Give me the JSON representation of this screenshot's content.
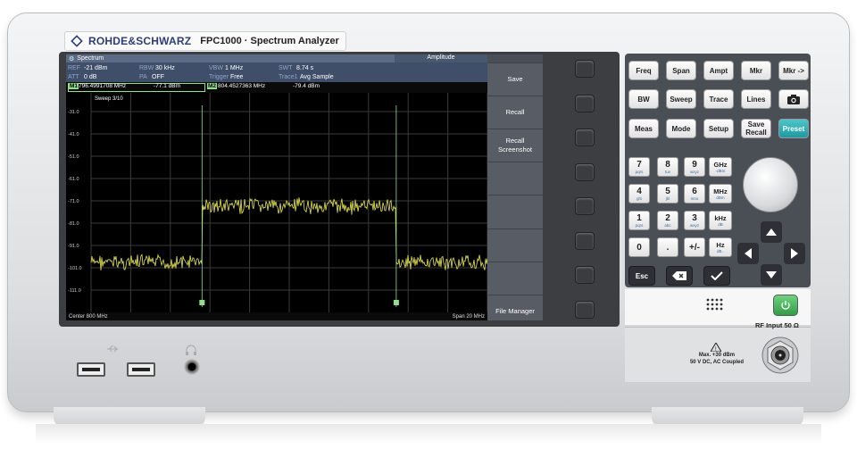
{
  "brand": {
    "name": "ROHDE&SCHWARZ",
    "model": "FPC1000 · Spectrum Analyzer"
  },
  "screen": {
    "mode_tab": "Spectrum",
    "menu_title": "Amplitude",
    "params": [
      {
        "label": "REF",
        "value": "-21 dBm"
      },
      {
        "label": "RBW",
        "value": "30 kHz"
      },
      {
        "label": "VBW",
        "value": "1 MHz"
      },
      {
        "label": "SWT",
        "value": "8.74 s"
      },
      {
        "label": "ATT",
        "value": "0 dB"
      },
      {
        "label": "PA",
        "value": "OFF"
      },
      {
        "label": "Trigger",
        "value": "Free"
      },
      {
        "label": "Trace1",
        "value": "Avg Sample"
      }
    ],
    "markers": [
      {
        "id": "M1",
        "freq": "796.4991708 MHz",
        "level": "-77.1 dBm"
      },
      {
        "id": "M2",
        "freq": "804.4527363 MHz",
        "level": "-79.4 dBm"
      }
    ],
    "sweep": "Sweep 3/10",
    "y_ticks": [
      "-31.0",
      "-41.0",
      "-51.0",
      "-61.0",
      "-71.0",
      "-81.0",
      "-91.0",
      "-101.0",
      "-111.0"
    ],
    "footer_left": "Center 800 MHz",
    "footer_right": "Span 20 MHz",
    "softkeys": [
      "Save",
      "Recall",
      "Recall\nScreenshot",
      "",
      "",
      "",
      "",
      "File Manager"
    ]
  },
  "keys": {
    "row1": [
      "Freq",
      "Span",
      "Ampt",
      "Mkr",
      "Mkr ->"
    ],
    "row2": [
      "BW",
      "Sweep",
      "Trace",
      "Lines",
      ""
    ],
    "row3": [
      "Meas",
      "Mode",
      "Setup",
      "Save\nRecall",
      "Preset"
    ],
    "numbers": [
      {
        "d": "7",
        "s": "pqrs"
      },
      {
        "d": "8",
        "s": "tuv"
      },
      {
        "d": "9",
        "s": "wxyz"
      },
      {
        "d": "4",
        "s": "ghi"
      },
      {
        "d": "5",
        "s": "jkl"
      },
      {
        "d": "6",
        "s": "mno"
      },
      {
        "d": "1",
        "s": "pqrs"
      },
      {
        "d": "2",
        "s": "abc"
      },
      {
        "d": "3",
        "s": "wxyz"
      },
      {
        "d": "0",
        "s": ""
      },
      {
        "d": ".",
        "s": ""
      },
      {
        "d": "+/-",
        "s": ""
      }
    ],
    "units": [
      {
        "d": "GHz",
        "s": "-dBm"
      },
      {
        "d": "MHz",
        "s": "dBm"
      },
      {
        "d": "kHz",
        "s": "dB"
      },
      {
        "d": "Hz",
        "s": "dB.."
      }
    ],
    "esc": "Esc"
  },
  "rf_input": {
    "label": "RF Input 50 Ω",
    "warning1": "Max. +30 dBm",
    "warning2": "50 V DC, AC Coupled"
  },
  "colors": {
    "trace": "#e6e64a",
    "grid": "#3a3a3a",
    "marker_line": "#8fe08a",
    "accent": "#2c3e78",
    "preset": "#27a9ae"
  }
}
